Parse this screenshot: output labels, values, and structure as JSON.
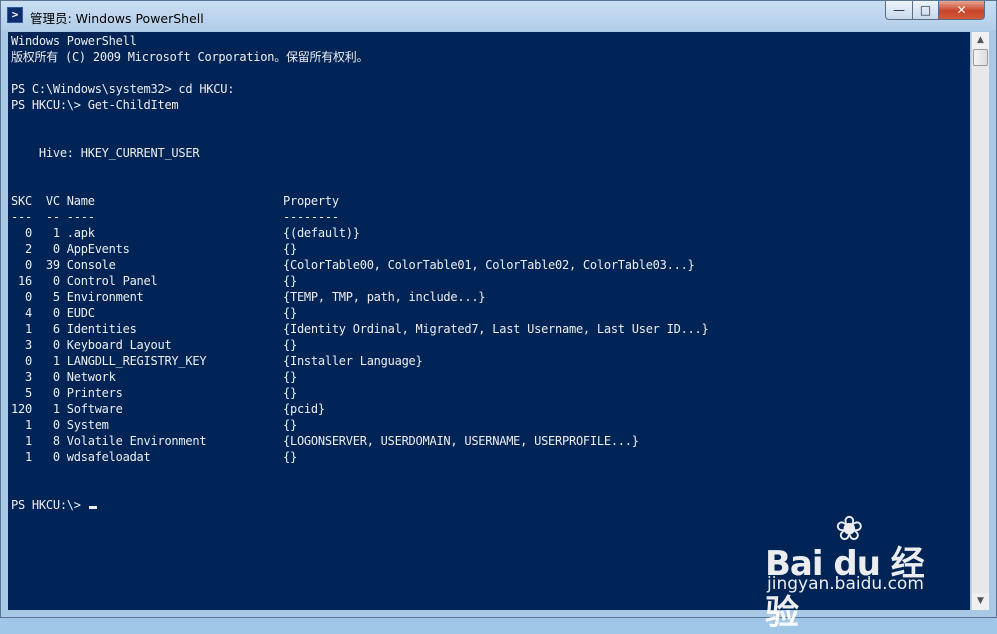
{
  "window": {
    "title": "管理员: Windows PowerShell",
    "app_icon_glyph": ">",
    "controls": {
      "minimize": "—",
      "maximize": "□",
      "close": "✕"
    }
  },
  "colors": {
    "console_bg": "#012456",
    "console_text": "#eeedf0",
    "title_bar": "#b3cde9",
    "close_button": "#c7442a"
  },
  "console": {
    "lines": [
      "Windows PowerShell",
      "版权所有 (C) 2009 Microsoft Corporation。保留所有权利。",
      "",
      "PS C:\\Windows\\system32> cd HKCU:",
      "PS HKCU:\\> Get-ChildItem",
      "",
      "",
      "    Hive: HKEY_CURRENT_USER",
      "",
      "",
      "SKC  VC Name                           Property",
      "---  -- ----                           --------",
      "  0   1 .apk                           {(default)}",
      "  2   0 AppEvents                      {}",
      "  0  39 Console                        {ColorTable00, ColorTable01, ColorTable02, ColorTable03...}",
      " 16   0 Control Panel                  {}",
      "  0   5 Environment                    {TEMP, TMP, path, include...}",
      "  4   0 EUDC                           {}",
      "  1   6 Identities                     {Identity Ordinal, Migrated7, Last Username, Last User ID...}",
      "  3   0 Keyboard Layout                {}",
      "  0   1 LANGDLL_REGISTRY_KEY           {Installer Language}",
      "  3   0 Network                        {}",
      "  5   0 Printers                       {}",
      "120   1 Software                       {pcid}",
      "  1   0 System                         {}",
      "  1   8 Volatile Environment           {LOGONSERVER, USERDOMAIN, USERNAME, USERPROFILE...}",
      "  1   0 wdsafeloadat                   {}",
      "",
      "",
      "PS HKCU:\\> "
    ]
  },
  "scrollbar": {
    "up_arrow": "▲",
    "down_arrow": "▼"
  },
  "watermark": {
    "paw": "❀",
    "main": "Bai du 经验",
    "sub": "jingyan.baidu.com"
  }
}
